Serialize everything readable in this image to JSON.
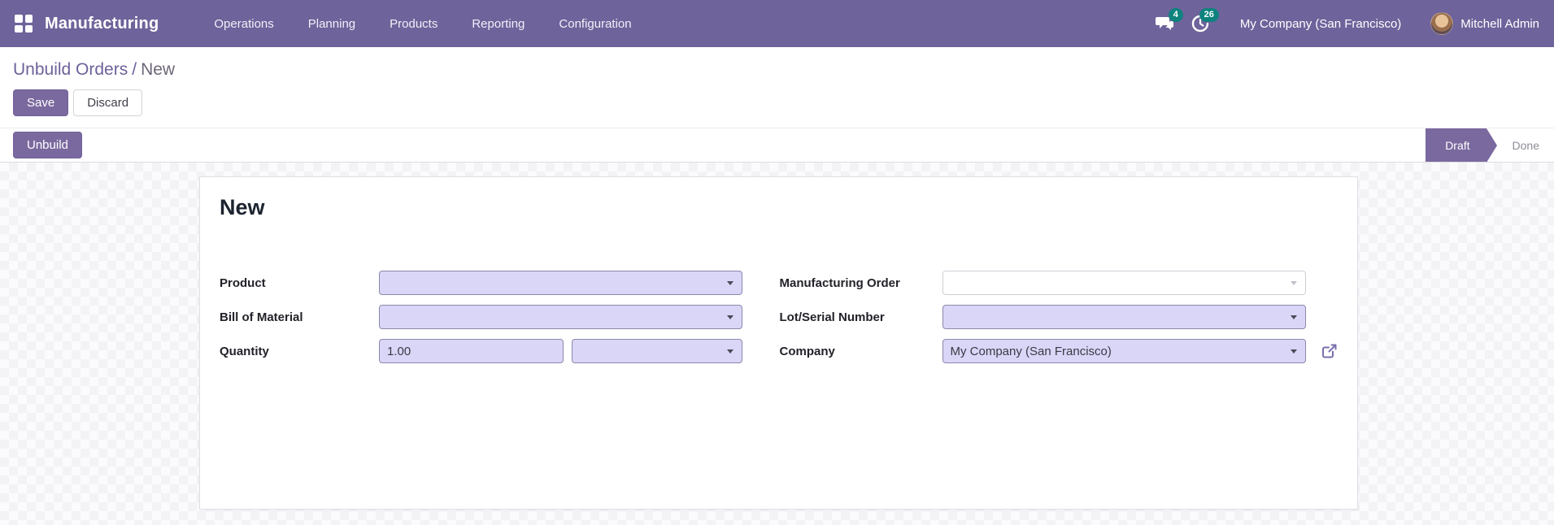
{
  "navbar": {
    "app_name": "Manufacturing",
    "menu_items": [
      {
        "label": "Operations"
      },
      {
        "label": "Planning"
      },
      {
        "label": "Products"
      },
      {
        "label": "Reporting"
      },
      {
        "label": "Configuration"
      }
    ],
    "messages_badge": "4",
    "activities_badge": "26",
    "company": "My Company (San Francisco)",
    "user": "Mitchell Admin",
    "colors": {
      "navbar_bg": "#6f639b",
      "badge": "#0e837e"
    }
  },
  "breadcrumb": {
    "parent": "Unbuild Orders",
    "separator": "/",
    "current": "New"
  },
  "actions": {
    "save": "Save",
    "discard": "Discard"
  },
  "statusbar": {
    "unbuild": "Unbuild",
    "states": [
      {
        "label": "Draft",
        "active": true
      },
      {
        "label": "Done",
        "active": false
      }
    ]
  },
  "form": {
    "title": "New",
    "fields": {
      "product": {
        "label": "Product",
        "value": ""
      },
      "bill_of_material": {
        "label": "Bill of Material",
        "value": ""
      },
      "quantity": {
        "label": "Quantity",
        "value": "1.00",
        "uom": ""
      },
      "manufacturing_order": {
        "label": "Manufacturing Order",
        "value": ""
      },
      "lot_serial": {
        "label": "Lot/Serial Number",
        "value": ""
      },
      "company": {
        "label": "Company",
        "value": "My Company (San Francisco)"
      }
    }
  },
  "colors": {
    "button_primary": "#7a699e",
    "field_bg": "#d9d6f8"
  }
}
